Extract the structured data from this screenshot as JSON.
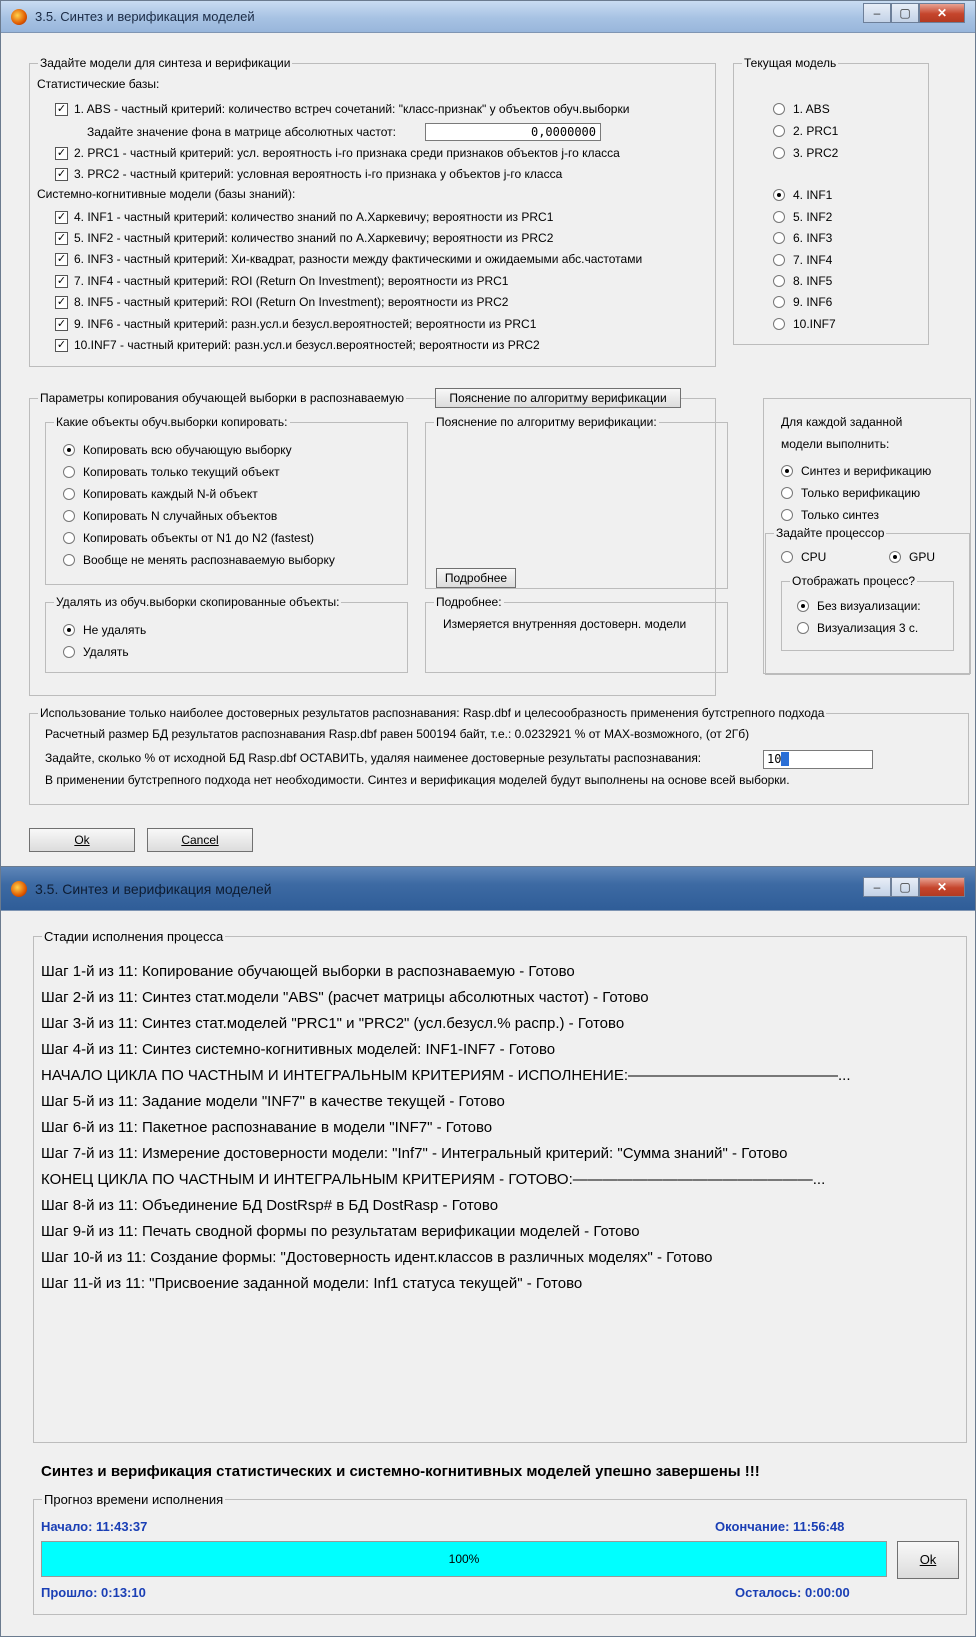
{
  "window1": {
    "title": "3.5. Синтез и верификация моделей",
    "models_group": {
      "label": "Задайте модели для синтеза и верификации",
      "stat_header": "Статистические базы:",
      "background_label": "Задайте значение фона в матрице абсолютных частот:",
      "background_value": "0,0000000",
      "sys_header": "Системно-когнитивные модели (базы знаний):",
      "items": [
        "1. ABS  - частный критерий: количество встреч сочетаний: \"класс-признак\" у объектов обуч.выборки",
        "2. PRC1 - частный критерий: усл. вероятность i-го признака среди признаков объектов j-го класса",
        "3. PRC2 - частный критерий: условная вероятность i-го признака у объектов j-го класса",
        "4. INF1 - частный критерий: количество знаний по А.Харкевичу; вероятности из PRC1",
        "5. INF2 - частный критерий: количество знаний по А.Харкевичу; вероятности из PRC2",
        "6. INF3 - частный критерий: Хи-квадрат, разности между фактическими и ожидаемыми абс.частотами",
        "7. INF4 - частный критерий: ROI (Return On Investment); вероятности из PRC1",
        "8. INF5 - частный критерий: ROI (Return On Investment); вероятности из PRC2",
        "9. INF6 - частный критерий: разн.усл.и безусл.вероятностей; вероятности из PRC1",
        "10.INF7 - частный критерий: разн.усл.и безусл.вероятностей; вероятности из PRC2"
      ]
    },
    "current_model": {
      "label": "Текущая модель",
      "options": [
        "1. ABS",
        "2. PRC1",
        "3. PRC2",
        "4. INF1",
        "5. INF2",
        "6. INF3",
        "7. INF4",
        "8. INF5",
        "9. INF6",
        "10.INF7"
      ],
      "selected": "4. INF1"
    },
    "copy_group": {
      "label": "Параметры копирования обучающей выборки в распознаваемую",
      "explain_button": "Пояснение по алгоритму верификации",
      "which_label": "Какие объекты обуч.выборки копировать:",
      "which_options": [
        "Копировать всю обучающую выборку",
        "Копировать только текущий объект",
        "Копировать каждый N-й объект",
        "Копировать N случайных объектов",
        "Копировать объекты от N1 до N2 (fastest)",
        "Вообще не менять распознаваемую выборку"
      ],
      "explain_label": "Пояснение по алгоритму верификации:",
      "more_button": "Подробнее",
      "delete_label": "Удалять из обуч.выборки скопированные объекты:",
      "delete_options": [
        "Не удалять",
        "Удалять"
      ],
      "more_label": "Подробнее:",
      "more_text": "Измеряется внутренняя достоверн. модели"
    },
    "each_model": {
      "label1": "Для каждой заданной",
      "label2": "модели выполнить:",
      "options": [
        "Синтез и верификацию",
        "Только  верификацию",
        "Только  синтез"
      ]
    },
    "processor": {
      "label": "Задайте процессор",
      "cpu": "CPU",
      "gpu": "GPU",
      "display_label": "Отображать процесс?",
      "display_options": [
        "Без визуализации:",
        "Визуализация 3 с."
      ]
    },
    "bootstrap": {
      "label": "Использование только наиболее достоверных результатов распознавания: Rasp.dbf и целесообразность применения бутстрепного подхода",
      "line1": "Расчетный размер БД результатов распознавания Rasp.dbf равен 500194 байт, т.е.: 0.0232921 % от MAX-возможного, (от 2Гб)",
      "line2": "Задайте, сколько % от исходной БД Rasp.dbf ОСТАВИТЬ, удаляя наименее достоверные результаты распознавания:",
      "percent_value": "10",
      "line3": "В применении бутстрепного подхода нет необходимости. Синтез и верификация моделей будут выполнены на основе всей выборки."
    },
    "ok": "Ok",
    "cancel": "Cancel"
  },
  "window2": {
    "title": "3.5. Синтез и верификация моделей",
    "stages_label": "Стадии исполнения процесса",
    "steps": [
      "Шаг 1-й из 11: Копирование обучающей выборки в распознаваемую - Готово",
      "Шаг 2-й из 11: Синтез стат.модели \"ABS\" (расчет матрицы абсолютных частот) - Готово",
      "Шаг 3-й из 11: Синтез стат.моделей \"PRC1\" и \"PRC2\" (усл.безусл.% распр.) - Готово",
      "Шаг 4-й из 11: Синтез системно-когнитивных моделей: INF1-INF7 - Готово",
      "НАЧАЛО ЦИКЛА ПО ЧАСТНЫМ И ИНТЕГРАЛЬНЫМ КРИТЕРИЯМ - ИСПОЛНЕНИЕ:——————————————...",
      "Шаг 5-й из 11: Задание модели \"INF7\" в качестве текущей - Готово",
      "Шаг 6-й из 11: Пакетное распознавание в модели \"INF7\" - Готово",
      "Шаг 7-й из 11: Измерение достоверности модели: \"Inf7\" - Интегральный критерий: \"Сумма знаний\" - Готово",
      "КОНЕЦ ЦИКЛА ПО ЧАСТНЫМ И ИНТЕГРАЛЬНЫМ КРИТЕРИЯМ - ГОТОВО:————————————————...",
      "Шаг 8-й из 11: Объединение БД DostRsp# в БД DostRasp - Готово",
      "Шаг 9-й из 11: Печать сводной формы по результатам верификации моделей - Готово",
      "Шаг 10-й из 11: Создание формы: \"Достоверность идент.классов в различных моделях\" - Готово",
      "Шаг 11-й из 11: \"Присвоение заданной модели: Inf1 статуса текущей\" - Готово"
    ],
    "result": "Синтез и верификация статистических и системно-когнитивных моделей упешно завершены !!!",
    "forecast_label": "Прогноз времени исполнения",
    "start": "Начало: 11:43:37",
    "end": "Окончание: 11:56:48",
    "progress_text": "100%",
    "progress_value": 100,
    "elapsed": "Прошло: 0:13:10",
    "remaining": "Осталось: 0:00:00",
    "ok": "Ok",
    "progress_color": "#00ffff"
  }
}
